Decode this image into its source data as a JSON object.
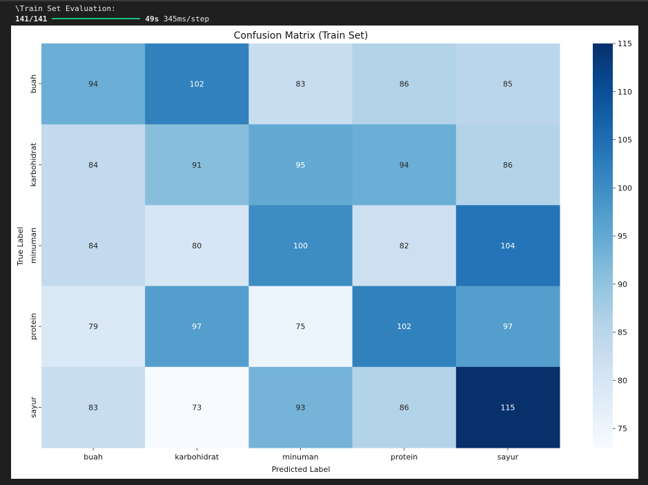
{
  "console": {
    "title": "\\Train Set Evaluation:",
    "step_count": "141/141",
    "timing_total": "49s",
    "timing_step": "345ms/step",
    "progress": 1.0,
    "progress_color": "#19c37d"
  },
  "chart_data": {
    "type": "heatmap",
    "title": "Confusion Matrix (Train Set)",
    "xlabel": "Predicted Label",
    "ylabel": "True Label",
    "x_categories": [
      "buah",
      "karbohidrat",
      "minuman",
      "protein",
      "sayur"
    ],
    "y_categories": [
      "buah",
      "karbohidrat",
      "minuman",
      "protein",
      "sayur"
    ],
    "values": [
      [
        94,
        102,
        83,
        86,
        85
      ],
      [
        84,
        91,
        95,
        94,
        86
      ],
      [
        84,
        80,
        100,
        82,
        104
      ],
      [
        79,
        97,
        75,
        102,
        97
      ],
      [
        83,
        73,
        93,
        86,
        115
      ]
    ],
    "colormap": "Blues",
    "vmin": 73,
    "vmax": 115,
    "colorbar_ticks": [
      75,
      80,
      85,
      90,
      95,
      100,
      105,
      110,
      115
    ]
  }
}
